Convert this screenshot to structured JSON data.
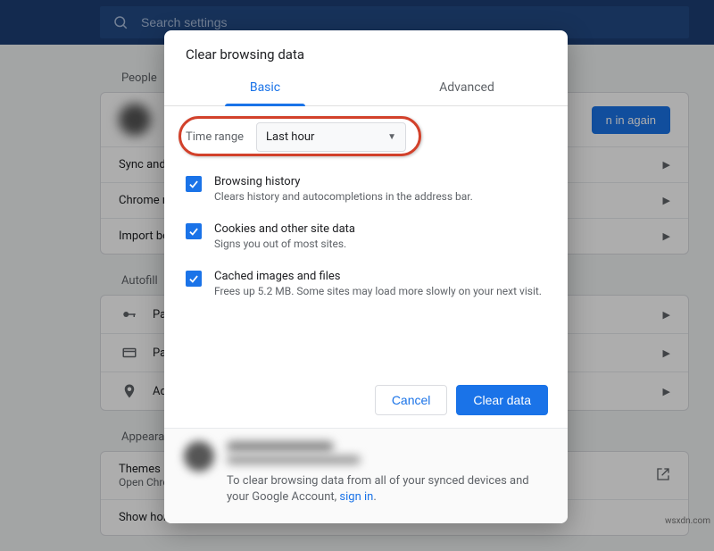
{
  "search": {
    "placeholder": "Search settings"
  },
  "sections": {
    "people_label": "People",
    "autofill_label": "Autofill",
    "appearance_label": "Appearance"
  },
  "people_rows": {
    "signin_button": "n in again",
    "sync": "Sync and C",
    "chrome_name": "Chrome na",
    "import": "Import boo"
  },
  "autofill_rows": {
    "passwords": "Pas",
    "payments": "Pay",
    "addresses": "Ad"
  },
  "appearance_rows": {
    "themes_title": "Themes",
    "themes_sub": "Open Chro",
    "show_home": "Show home button"
  },
  "dialog": {
    "title": "Clear browsing data",
    "tab_basic": "Basic",
    "tab_advanced": "Advanced",
    "time_range_label": "Time range",
    "time_range_value": "Last hour",
    "options": [
      {
        "title": "Browsing history",
        "desc": "Clears history and autocompletions in the address bar."
      },
      {
        "title": "Cookies and other site data",
        "desc": "Signs you out of most sites."
      },
      {
        "title": "Cached images and files",
        "desc": "Frees up 5.2 MB. Some sites may load more slowly on your next visit."
      }
    ],
    "cancel": "Cancel",
    "clear": "Clear data",
    "footer_text": "To clear browsing data from all of your synced devices and your Google Account, ",
    "footer_link": "sign in"
  },
  "watermark": "wsxdn.com"
}
